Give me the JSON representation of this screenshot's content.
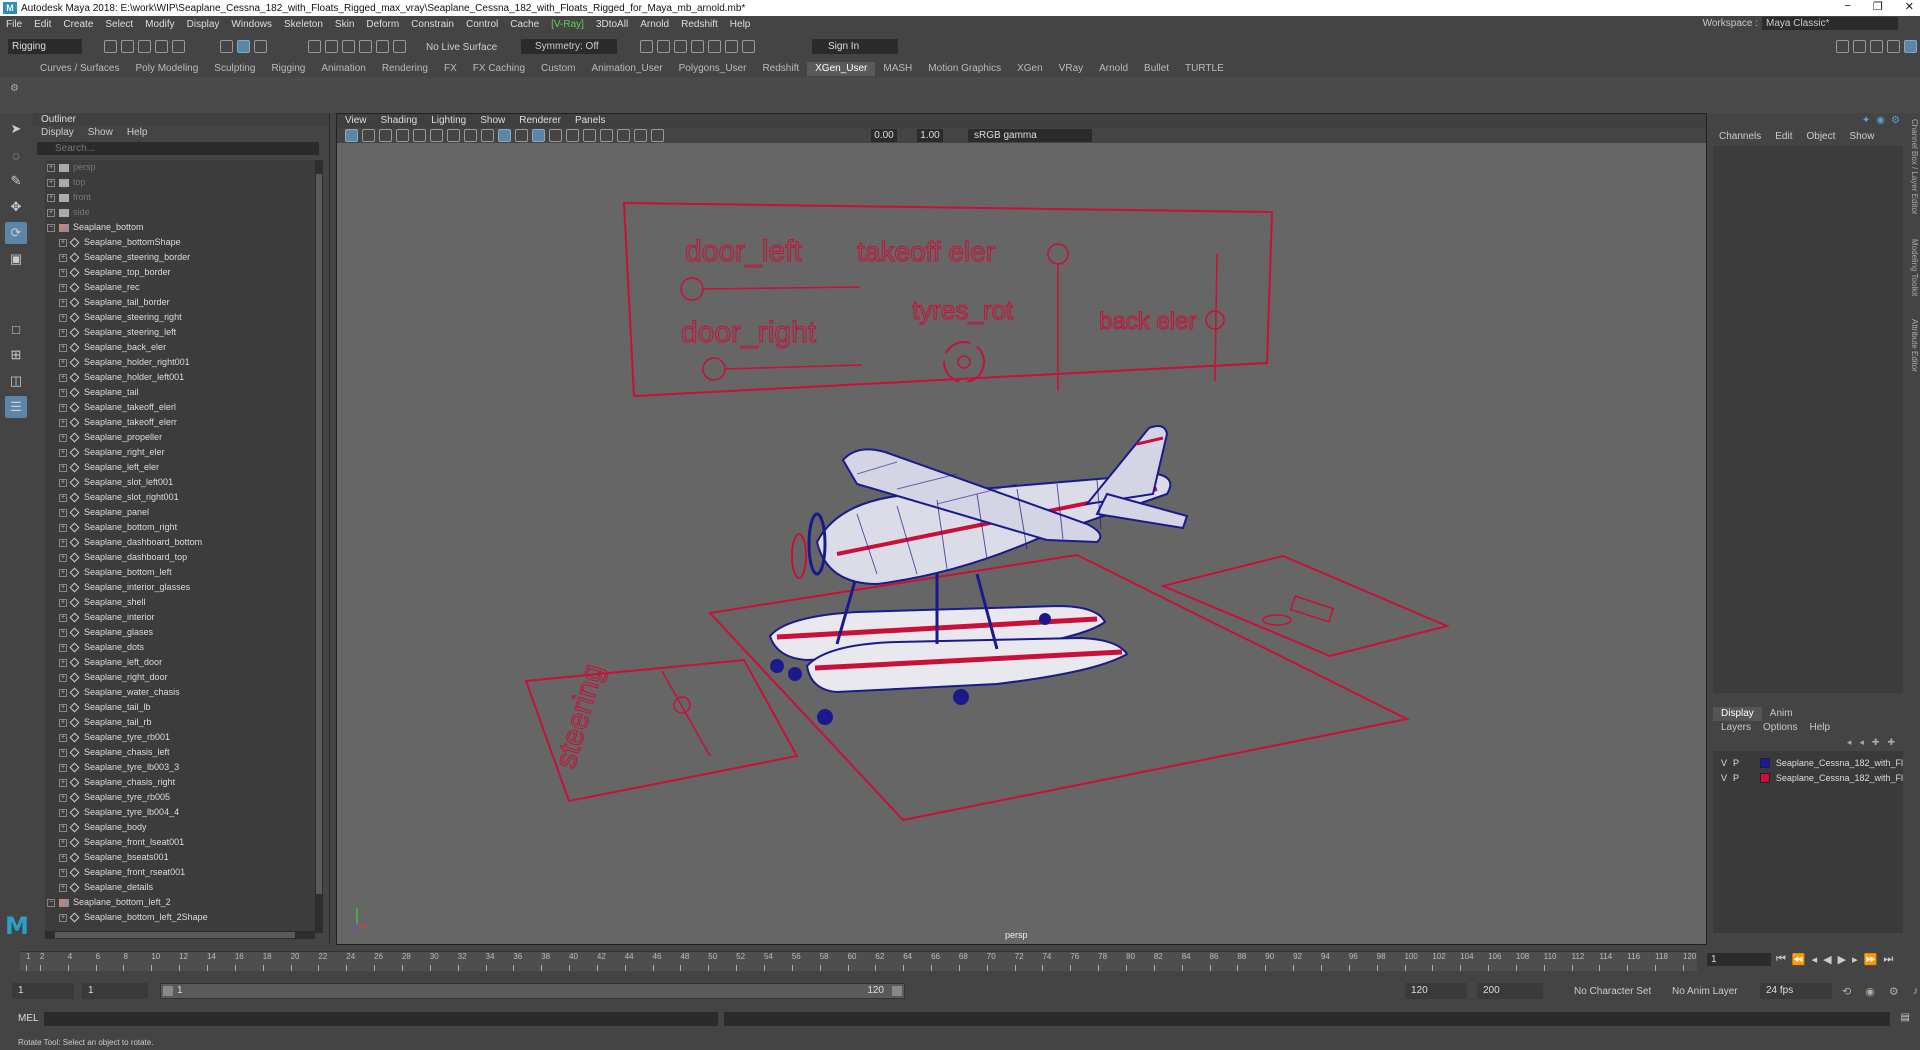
{
  "window": {
    "title": "Autodesk Maya 2018: E:\\work\\WIP\\Seaplane_Cessna_182_with_Floats_Rigged_max_vray\\Seaplane_Cessna_182_with_Floats_Rigged_for_Maya_mb_arnold.mb*",
    "logo": "M",
    "minimize": "−",
    "restore": "❐",
    "close": "✕"
  },
  "menubar": {
    "items": [
      "File",
      "Edit",
      "Create",
      "Select",
      "Modify",
      "Display",
      "Windows",
      "Skeleton",
      "Skin",
      "Deform",
      "Constrain",
      "Control",
      "Cache",
      "[V-Ray]",
      "3DtoAll",
      "Arnold",
      "Redshift",
      "Help"
    ],
    "workspace_label": "Workspace :",
    "workspace_value": "Maya Classic*"
  },
  "statusline": {
    "mode": "Rigging",
    "live_surface": "No Live Surface",
    "symmetry": "Symmetry: Off",
    "sign_in": "Sign In"
  },
  "shelf_tabs": [
    "Curves / Surfaces",
    "Poly Modeling",
    "Sculpting",
    "Rigging",
    "Animation",
    "Rendering",
    "FX",
    "FX Caching",
    "Custom",
    "Animation_User",
    "Polygons_User",
    "Redshift",
    "XGen_User",
    "MASH",
    "Motion Graphics",
    "XGen",
    "VRay",
    "Arnold",
    "Bullet",
    "TURTLE"
  ],
  "shelf_active": "XGen_User",
  "outliner": {
    "title": "Outliner",
    "menu": [
      "Display",
      "Show",
      "Help"
    ],
    "search_placeholder": "Search...",
    "nodes": [
      {
        "label": "persp",
        "type": "cam",
        "dim": true,
        "indent": 0
      },
      {
        "label": "top",
        "type": "cam",
        "dim": true,
        "indent": 0
      },
      {
        "label": "front",
        "type": "cam",
        "dim": true,
        "indent": 0
      },
      {
        "label": "side",
        "type": "cam",
        "dim": true,
        "indent": 0
      },
      {
        "label": "Seaplane_bottom",
        "type": "group",
        "dim": false,
        "indent": 0
      },
      {
        "label": "Seaplane_bottomShape",
        "type": "mesh",
        "dim": false,
        "indent": 1
      },
      {
        "label": "Seaplane_steering_border",
        "type": "mesh",
        "dim": false,
        "indent": 1
      },
      {
        "label": "Seaplane_top_border",
        "type": "mesh",
        "dim": false,
        "indent": 1
      },
      {
        "label": "Seaplane_rec",
        "type": "mesh",
        "dim": false,
        "indent": 1
      },
      {
        "label": "Seaplane_tail_border",
        "type": "mesh",
        "dim": false,
        "indent": 1
      },
      {
        "label": "Seaplane_steering_right",
        "type": "mesh",
        "dim": false,
        "indent": 1
      },
      {
        "label": "Seaplane_steering_left",
        "type": "mesh",
        "dim": false,
        "indent": 1
      },
      {
        "label": "Seaplane_back_eler",
        "type": "mesh",
        "dim": false,
        "indent": 1
      },
      {
        "label": "Seaplane_holder_right001",
        "type": "mesh",
        "dim": false,
        "indent": 1
      },
      {
        "label": "Seaplane_holder_left001",
        "type": "mesh",
        "dim": false,
        "indent": 1
      },
      {
        "label": "Seaplane_tail",
        "type": "mesh",
        "dim": false,
        "indent": 1
      },
      {
        "label": "Seaplane_takeoff_elerl",
        "type": "mesh",
        "dim": false,
        "indent": 1
      },
      {
        "label": "Seaplane_takeoff_elerr",
        "type": "mesh",
        "dim": false,
        "indent": 1
      },
      {
        "label": "Seaplane_propeller",
        "type": "mesh",
        "dim": false,
        "indent": 1
      },
      {
        "label": "Seaplane_right_eler",
        "type": "mesh",
        "dim": false,
        "indent": 1
      },
      {
        "label": "Seaplane_left_eler",
        "type": "mesh",
        "dim": false,
        "indent": 1
      },
      {
        "label": "Seaplane_slot_left001",
        "type": "mesh",
        "dim": false,
        "indent": 1
      },
      {
        "label": "Seaplane_slot_right001",
        "type": "mesh",
        "dim": false,
        "indent": 1
      },
      {
        "label": "Seaplane_panel",
        "type": "mesh",
        "dim": false,
        "indent": 1
      },
      {
        "label": "Seaplane_bottom_right",
        "type": "mesh",
        "dim": false,
        "indent": 1
      },
      {
        "label": "Seaplane_dashboard_bottom",
        "type": "mesh",
        "dim": false,
        "indent": 1
      },
      {
        "label": "Seaplane_dashboard_top",
        "type": "mesh",
        "dim": false,
        "indent": 1
      },
      {
        "label": "Seaplane_bottom_left",
        "type": "mesh",
        "dim": false,
        "indent": 1
      },
      {
        "label": "Seaplane_interior_glasses",
        "type": "mesh",
        "dim": false,
        "indent": 1
      },
      {
        "label": "Seaplane_shell",
        "type": "mesh",
        "dim": false,
        "indent": 1
      },
      {
        "label": "Seaplane_interior",
        "type": "mesh",
        "dim": false,
        "indent": 1
      },
      {
        "label": "Seaplane_glases",
        "type": "mesh",
        "dim": false,
        "indent": 1
      },
      {
        "label": "Seaplane_dots",
        "type": "mesh",
        "dim": false,
        "indent": 1
      },
      {
        "label": "Seaplane_left_door",
        "type": "mesh",
        "dim": false,
        "indent": 1
      },
      {
        "label": "Seaplane_right_door",
        "type": "mesh",
        "dim": false,
        "indent": 1
      },
      {
        "label": "Seaplane_water_chasis",
        "type": "mesh",
        "dim": false,
        "indent": 1
      },
      {
        "label": "Seaplane_tail_lb",
        "type": "mesh",
        "dim": false,
        "indent": 1
      },
      {
        "label": "Seaplane_tail_rb",
        "type": "mesh",
        "dim": false,
        "indent": 1
      },
      {
        "label": "Seaplane_tyre_rb001",
        "type": "mesh",
        "dim": false,
        "indent": 1
      },
      {
        "label": "Seaplane_chasis_left",
        "type": "mesh",
        "dim": false,
        "indent": 1
      },
      {
        "label": "Seaplane_tyre_lb003_3",
        "type": "mesh",
        "dim": false,
        "indent": 1
      },
      {
        "label": "Seaplane_chasis_right",
        "type": "mesh",
        "dim": false,
        "indent": 1
      },
      {
        "label": "Seaplane_tyre_rb005",
        "type": "mesh",
        "dim": false,
        "indent": 1
      },
      {
        "label": "Seaplane_tyre_lb004_4",
        "type": "mesh",
        "dim": false,
        "indent": 1
      },
      {
        "label": "Seaplane_body",
        "type": "mesh",
        "dim": false,
        "indent": 1
      },
      {
        "label": "Seaplane_front_lseat001",
        "type": "mesh",
        "dim": false,
        "indent": 1
      },
      {
        "label": "Seaplane_bseats001",
        "type": "mesh",
        "dim": false,
        "indent": 1
      },
      {
        "label": "Seaplane_front_rseat001",
        "type": "mesh",
        "dim": false,
        "indent": 1
      },
      {
        "label": "Seaplane_details",
        "type": "mesh",
        "dim": false,
        "indent": 1
      },
      {
        "label": "Seaplane_bottom_left_2",
        "type": "group",
        "dim": false,
        "indent": 0
      },
      {
        "label": "Seaplane_bottom_left_2Shape",
        "type": "mesh",
        "dim": false,
        "indent": 1
      }
    ]
  },
  "viewport": {
    "menu": [
      "View",
      "Shading",
      "Lighting",
      "Show",
      "Renderer",
      "Panels"
    ],
    "exposure": "0.00",
    "gamma_value": "1.00",
    "color_space": "sRGB gamma",
    "camera": "persp",
    "rig_labels": {
      "door_left": "door_left",
      "door_right": "door_right",
      "takeoff_eler": "takeoff eler",
      "tyres_rot": "tyres_rot",
      "back_eler": "back eler",
      "steering": "steering"
    },
    "rig_color": "#c8103a",
    "wire_blue": "#1a1a8c"
  },
  "channelbox": {
    "menu": [
      "Channels",
      "Edit",
      "Object",
      "Show"
    ],
    "layer_tabs": [
      "Display",
      "Anim"
    ],
    "layer_menu": [
      "Layers",
      "Options",
      "Help"
    ],
    "layers": [
      {
        "v": "V",
        "p": "P",
        "color": "#1a1a9a",
        "name": "Seaplane_Cessna_182_with_Fl"
      },
      {
        "v": "V",
        "p": "P",
        "color": "#c8103a",
        "name": "Seaplane_Cessna_182_with_Fl"
      }
    ],
    "side_tabs": [
      "Channel Box / Layer Editor",
      "Modeling Toolkit",
      "Attribute Editor"
    ]
  },
  "timeslider": {
    "ticks": [
      "1",
      "2",
      "4",
      "6",
      "8",
      "10",
      "12",
      "14",
      "16",
      "18",
      "20",
      "22",
      "24",
      "26",
      "28",
      "30",
      "32",
      "34",
      "36",
      "38",
      "40",
      "42",
      "44",
      "46",
      "48",
      "50",
      "52",
      "54",
      "56",
      "58",
      "60",
      "62",
      "64",
      "66",
      "68",
      "70",
      "72",
      "74",
      "76",
      "78",
      "80",
      "82",
      "84",
      "86",
      "88",
      "90",
      "92",
      "94",
      "96",
      "98",
      "100",
      "102",
      "104",
      "106",
      "108",
      "110",
      "112",
      "114",
      "116",
      "118",
      "120"
    ],
    "current_frame": "1"
  },
  "rangeslider": {
    "start": "1",
    "playback_start": "1",
    "bar_start": "1",
    "bar_end": "120",
    "playback_end": "120",
    "end": "200",
    "character_set": "No Character Set",
    "anim_layer": "No Anim Layer",
    "fps": "24 fps"
  },
  "cmdline": {
    "label": "MEL"
  },
  "helpline": {
    "text": "Rotate Tool: Select an object to rotate."
  }
}
